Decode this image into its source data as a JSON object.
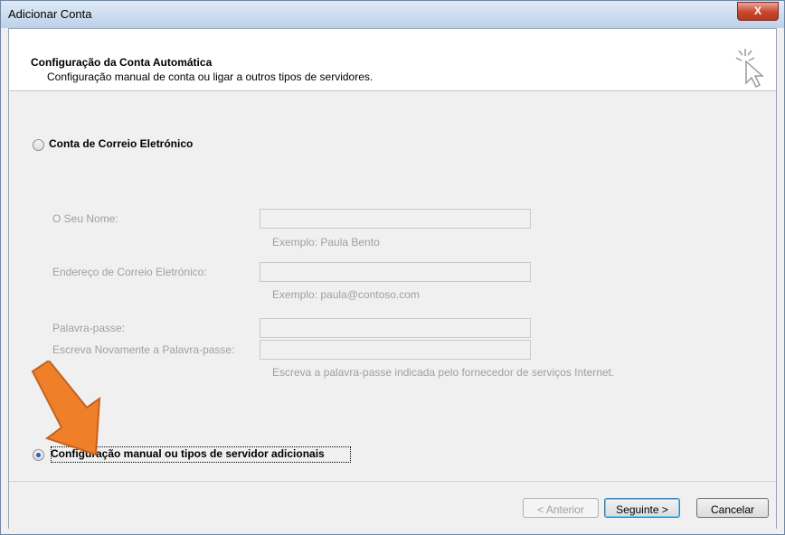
{
  "window": {
    "title": "Adicionar Conta",
    "close_label": "X"
  },
  "header": {
    "title": "Configuração da Conta Automática",
    "subtitle": "Configuração manual de conta ou ligar a outros tipos de servidores."
  },
  "options": {
    "email_account": {
      "label": "Conta de Correio Eletrónico",
      "selected": false
    },
    "manual_config": {
      "label": "Configuração manual ou tipos de servidor adicionais",
      "selected": true
    }
  },
  "form": {
    "name": {
      "label": "O Seu Nome:",
      "value": "",
      "hint": "Exemplo: Paula Bento"
    },
    "email": {
      "label": "Endereço de Correio Eletrónico:",
      "value": "",
      "hint": "Exemplo: paula@contoso.com"
    },
    "password": {
      "label": "Palavra-passe:",
      "value": ""
    },
    "password_repeat": {
      "label": "Escreva Novamente a Palavra-passe:",
      "value": "",
      "hint": "Escreva a palavra-passe indicada pelo fornecedor de serviços Internet."
    }
  },
  "buttons": {
    "back": "< Anterior",
    "next": "Seguinte >",
    "cancel": "Cancelar"
  },
  "colors": {
    "arrow": "#f07f2a",
    "radio_selected": "#2a64b8"
  },
  "icons": [
    "close-icon",
    "wizard-cursor-icon",
    "arrow-pointer-icon"
  ]
}
